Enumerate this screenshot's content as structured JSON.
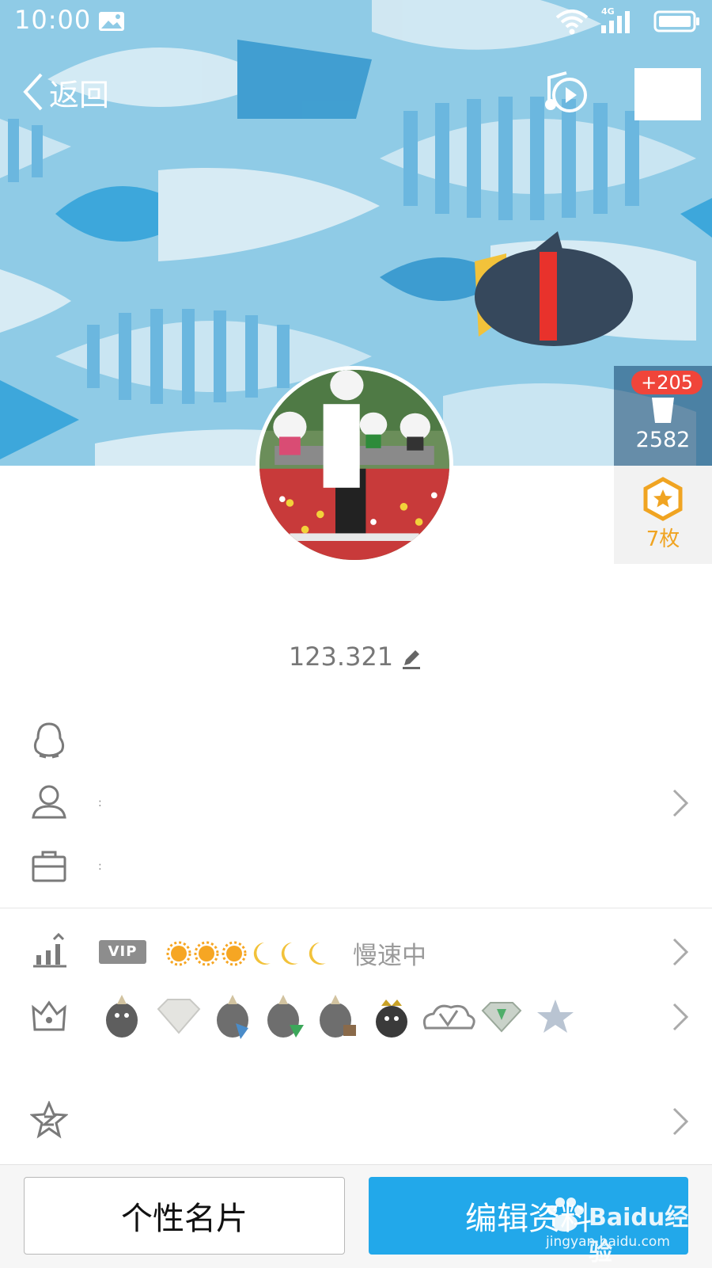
{
  "status_bar": {
    "time": "10:00",
    "network": "4G"
  },
  "nav": {
    "back_label": "返回"
  },
  "side_panel": {
    "likes_badge": "+205",
    "likes_count": "2582",
    "badge_count": "7枚"
  },
  "profile": {
    "name": "",
    "qq_number": "123.321"
  },
  "info_rows": {
    "colon": ":"
  },
  "level": {
    "vip_label": "VIP",
    "speed_text": "慢速中"
  },
  "footer": {
    "card_button": "个性名片",
    "edit_button": "编辑资料"
  },
  "watermark": {
    "brand": "Baidu经验",
    "url": "jingyan.baidu.com"
  },
  "colors": {
    "accent": "#22a8ea",
    "badge_red": "#f0453a",
    "gold": "#f0a422"
  }
}
